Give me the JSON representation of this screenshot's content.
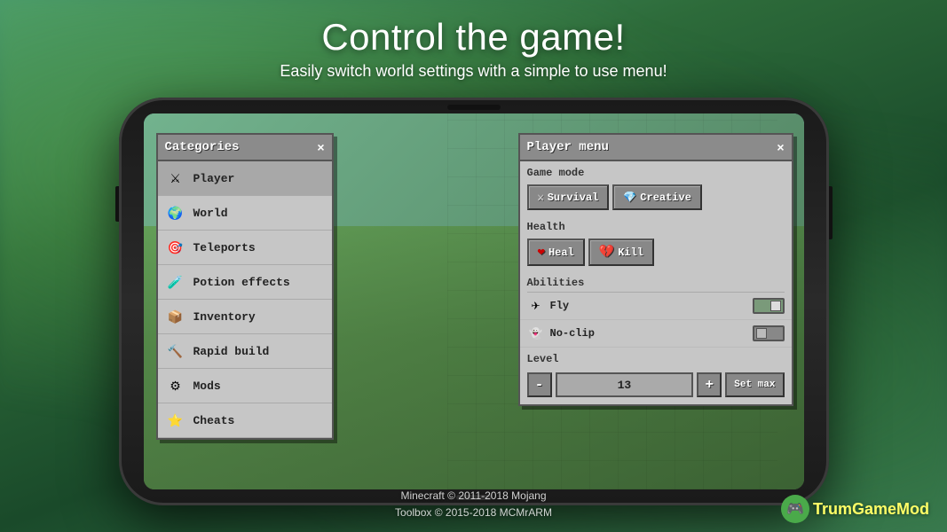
{
  "page": {
    "main_title": "Control the game!",
    "sub_title": "Easily switch world settings with a simple to use menu!",
    "footer_line1": "Minecraft © 2011-2018 Mojang",
    "footer_line2": "Toolbox © 2015-2018 MCMrARM",
    "logo_text_1": "Trum",
    "logo_text_2": "Game",
    "logo_text_3": "Mod"
  },
  "categories_panel": {
    "title": "Categories",
    "close": "×",
    "items": [
      {
        "id": "player",
        "label": "Player",
        "icon": "sword",
        "active": true
      },
      {
        "id": "world",
        "label": "World",
        "icon": "world",
        "active": false
      },
      {
        "id": "teleports",
        "label": "Teleports",
        "icon": "teleport",
        "active": false
      },
      {
        "id": "potion-effects",
        "label": "Potion effects",
        "icon": "potion",
        "active": false
      },
      {
        "id": "inventory",
        "label": "Inventory",
        "icon": "inventory",
        "active": false
      },
      {
        "id": "rapid-build",
        "label": "Rapid build",
        "icon": "build",
        "active": false
      },
      {
        "id": "mods",
        "label": "Mods",
        "icon": "mods",
        "active": false
      },
      {
        "id": "cheats",
        "label": "Cheats",
        "icon": "cheats",
        "active": false
      }
    ]
  },
  "player_panel": {
    "title": "Player menu",
    "close": "×",
    "game_mode_label": "Game mode",
    "survival_button": "Survival",
    "creative_button": "Creative",
    "health_label": "Health",
    "heal_button": "Heal",
    "kill_button": "Kill",
    "abilities_label": "Abilities",
    "fly_label": "Fly",
    "noclip_label": "No-clip",
    "level_label": "Level",
    "level_value": "13",
    "minus_button": "-",
    "plus_button": "+",
    "set_max_button": "Set max"
  }
}
